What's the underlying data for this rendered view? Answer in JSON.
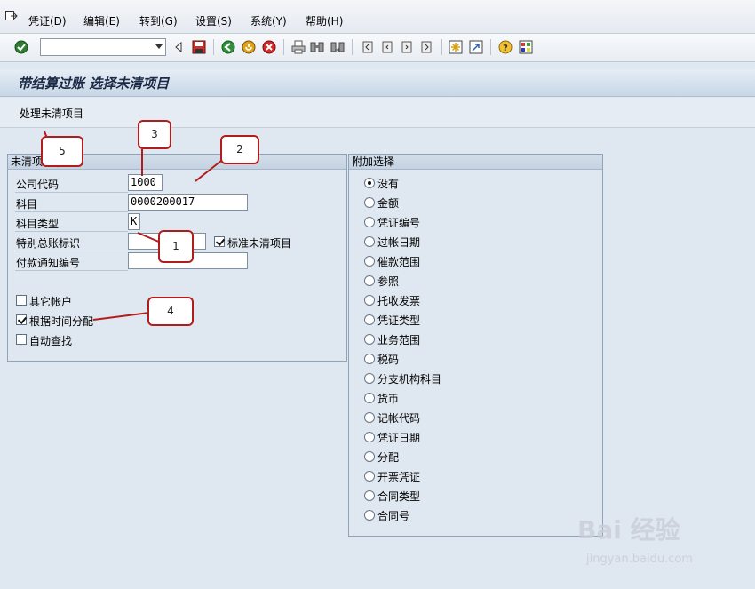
{
  "menu": {
    "items": [
      "凭证(D)",
      "编辑(E)",
      "转到(G)",
      "设置(S)",
      "系统(Y)",
      "帮助(H)"
    ]
  },
  "toolbar": {
    "command_value": "",
    "icons": [
      "enter-icon",
      "back-icon",
      "save-icon",
      "back-green-icon",
      "exit-icon",
      "cancel-icon",
      "print-icon",
      "find-icon",
      "find-next-icon",
      "first-page-icon",
      "prev-page-icon",
      "next-page-icon",
      "last-page-icon",
      "new-session-icon",
      "shortcut-icon",
      "help-icon",
      "layout-icon"
    ]
  },
  "title": "带结算过账 选择未清项目",
  "app_toolbar": {
    "process_button": "处理未清项目"
  },
  "open_items": {
    "title": "未清项",
    "company_code_label": "公司代码",
    "company_code_value": "1000",
    "account_label": "科目",
    "account_value": "0000200017",
    "account_type_label": "科目类型",
    "account_type_value": "K",
    "special_gl_label": "特别总账标识",
    "special_gl_value": "",
    "standard_oi_label": "标准未清项目",
    "standard_oi_checked": true,
    "payment_advice_label": "付款通知编号",
    "payment_advice_value": "",
    "other_accounts_label": "其它帐户",
    "other_accounts_checked": false,
    "distribute_by_age_label": "根据时间分配",
    "distribute_by_age_checked": true,
    "automatic_search_label": "自动查找",
    "automatic_search_checked": false
  },
  "additional_selections": {
    "title": "附加选择",
    "options": [
      "没有",
      "金额",
      "凭证编号",
      "过帐日期",
      "催款范围",
      "参照",
      "托收发票",
      "凭证类型",
      "业务范围",
      "税码",
      "分支机构科目",
      "货币",
      "记帐代码",
      "凭证日期",
      "分配",
      "开票凭证",
      "合同类型",
      "合同号"
    ],
    "selected_index": 0
  },
  "callouts": [
    "1",
    "2",
    "3",
    "4",
    "5"
  ],
  "watermark": {
    "brand": "Bai 经验",
    "url": "jingyan.baidu.com"
  },
  "colors": {
    "callout_border": "#b11d1d",
    "title_text": "#1a2a44"
  }
}
